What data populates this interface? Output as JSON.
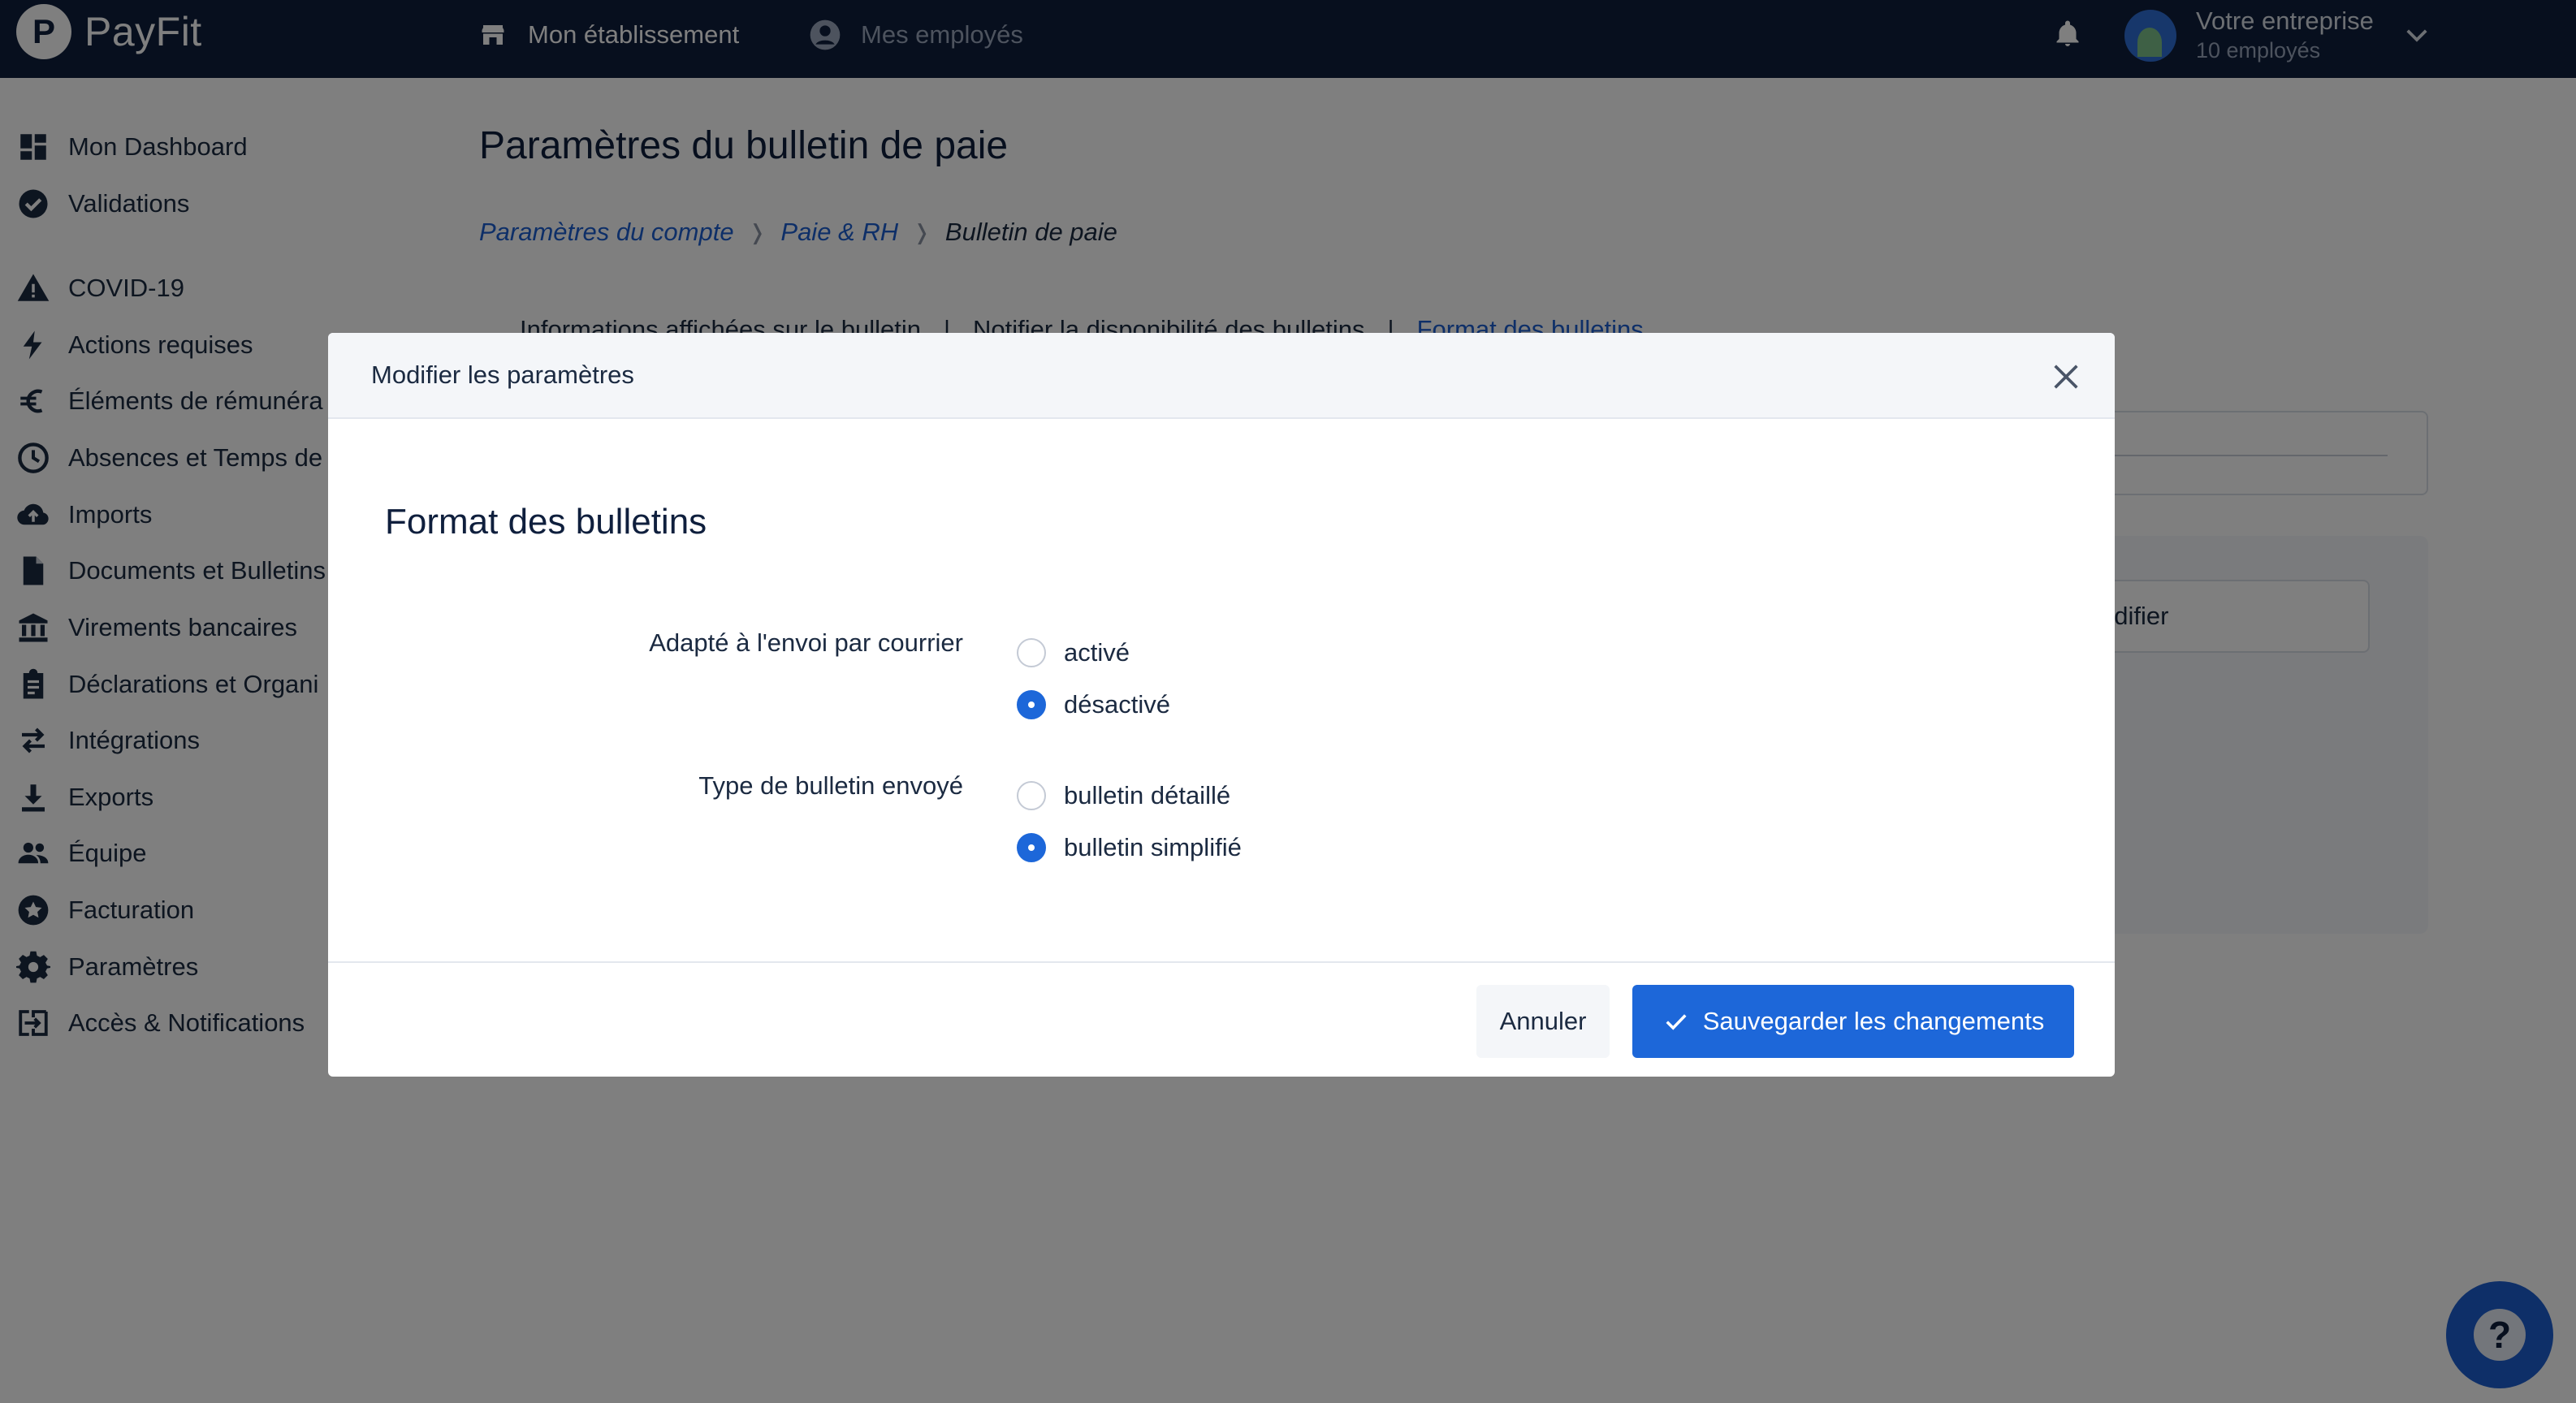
{
  "app": {
    "logo_letter": "P",
    "name": "PayFit"
  },
  "topnav": {
    "etablissement": "Mon établissement",
    "employes": "Mes employés"
  },
  "account": {
    "name": "Votre entreprise",
    "count": "10 employés"
  },
  "sidebar": {
    "items": [
      {
        "label": "Mon Dashboard",
        "icon": "dashboard-icon"
      },
      {
        "label": "Validations",
        "icon": "check-circle-icon"
      },
      {
        "label": "COVID-19",
        "icon": "warning-icon"
      },
      {
        "label": "Actions requises",
        "icon": "lightning-icon"
      },
      {
        "label": "Éléments de rémunéra",
        "icon": "euro-icon"
      },
      {
        "label": "Absences et Temps de",
        "icon": "clock-icon"
      },
      {
        "label": "Imports",
        "icon": "cloud-upload-icon"
      },
      {
        "label": "Documents et Bulletins",
        "icon": "document-icon"
      },
      {
        "label": "Virements bancaires",
        "icon": "bank-icon"
      },
      {
        "label": "Déclarations et Organi",
        "icon": "clipboard-icon"
      },
      {
        "label": "Intégrations",
        "icon": "swap-icon"
      },
      {
        "label": "Exports",
        "icon": "download-icon"
      },
      {
        "label": "Équipe",
        "icon": "team-icon"
      },
      {
        "label": "Facturation",
        "icon": "star-badge-icon"
      },
      {
        "label": "Paramètres",
        "icon": "gear-icon"
      },
      {
        "label": "Accès & Notifications",
        "icon": "login-icon"
      }
    ]
  },
  "page": {
    "title": "Paramètres du bulletin de paie",
    "breadcrumb": {
      "link1": "Paramètres du compte",
      "link2": "Paie & RH",
      "current": "Bulletin de paie"
    },
    "subtabs": {
      "tab1": "Informations affichées sur le bulletin",
      "tab2": "Notifier la disponibilité des bulletins",
      "tab3": "Format des bulletins",
      "sep": "|"
    },
    "modifier_button": "odifier"
  },
  "modal": {
    "title": "Modifier les paramètres",
    "section_title": "Format des bulletins",
    "fields": [
      {
        "label": "Adapté à l'envoi par courrier",
        "options": [
          {
            "label": "activé",
            "checked": false
          },
          {
            "label": "désactivé",
            "checked": true
          }
        ]
      },
      {
        "label": "Type de bulletin envoyé",
        "options": [
          {
            "label": "bulletin détaillé",
            "checked": false
          },
          {
            "label": "bulletin simplifié",
            "checked": true
          }
        ]
      }
    ],
    "cancel_label": "Annuler",
    "save_label": "Sauvegarder les changements"
  },
  "help": {
    "label": "?"
  },
  "colors": {
    "topbar": "#0f1f3d",
    "accent": "#1d67d9",
    "link": "#1d5fd1"
  }
}
